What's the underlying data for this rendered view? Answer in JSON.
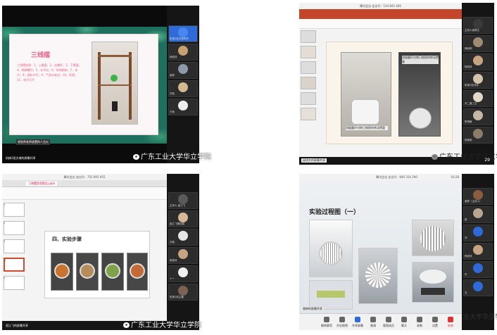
{
  "watermark": "广东工业大学华立学院",
  "tl": {
    "slide_title": "三线摆",
    "slide_body": "三线摆组成：1、上悬盘；2、支撑杆；3、下悬盘；4、底脚螺钉；5、水平仪；6、待测刚体；7、米尺；8、游标卡尺；9、气泡水准仪；10、秒表；11、电子天平",
    "share_text": "机械1班文城的屏幕共享",
    "caption": "规划师老师放置的人员仪",
    "self_label": "文城",
    "participants": [
      "机械1班文城同学",
      "杨成凤",
      "谢婷",
      "刘佳",
      "王秋"
    ]
  },
  "tr": {
    "meeting_bar": "腾讯会议 会议号：534 843 406",
    "slide_caption_left": "测量圆环对称已按照的转动惯量",
    "slide_caption_right": "测量圆环对称已按照的转动惯量",
    "share_text": "梁琪文的屏幕共享",
    "page_count": "29",
    "participants": [
      "主持人梁琪文",
      "杨晓明",
      "杨成凤",
      "机械1班冯伟",
      "冯二兽工艺",
      "陈慧敏",
      "徐振雨"
    ]
  },
  "bl": {
    "meeting_bar": "腾讯会议 会议号：752 893 055",
    "doc_tab": "三线摆实验报告.pptx",
    "slide_heading": "四、实验步骤",
    "share_text": "屈江飞的屏幕共享",
    "pages": [
      "1",
      "2",
      "3",
      "4",
      "5"
    ],
    "participants": [
      "主持人 屈江飞",
      "屈江飞第四组",
      "刘浩",
      "杨成凤",
      "十一",
      "机械1班主播"
    ]
  },
  "br": {
    "meeting_bar": "腾讯会议 会议号：846 314 290",
    "time": "03:28",
    "slide_heading": "实验过程图（一）",
    "share_text": "谢婷的屏幕共享",
    "participants": [
      "谢婷（主持人）",
      "夏",
      "刘",
      "杨成凤",
      "东",
      "文"
    ],
    "controls": [
      "解除静音",
      "开启视频",
      "共享屏幕",
      "邀请",
      "管理成员",
      "聊天",
      "录制",
      "设置",
      "结束"
    ]
  },
  "colors": {
    "meeting_bg": "#151515",
    "slide_pink": "#ea5a7e",
    "leaf_green": "#2f8a6f",
    "accent_blue": "#2f6bd8"
  }
}
